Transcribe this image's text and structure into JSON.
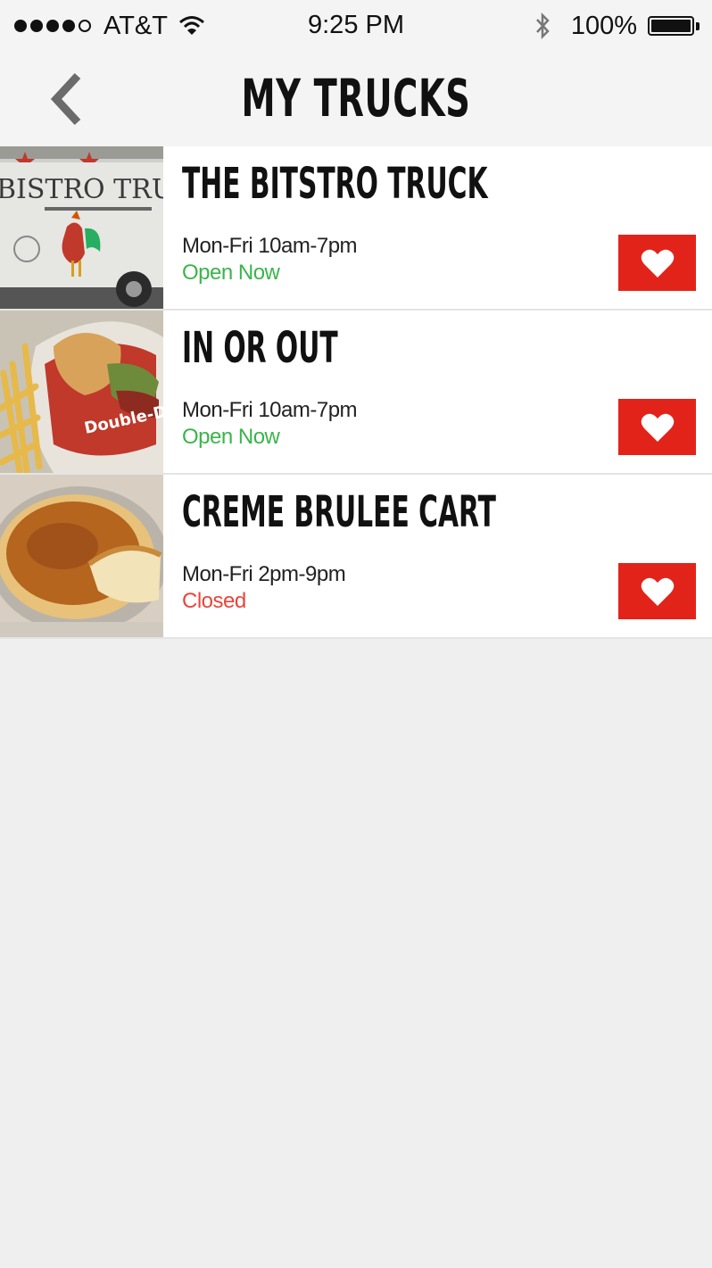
{
  "status_bar": {
    "carrier": "AT&T",
    "time": "9:25 PM",
    "battery": "100%",
    "signal_bars": 4,
    "signal_total": 5
  },
  "nav": {
    "title": "MY TRUCKS",
    "back_icon": "chevron-left-icon"
  },
  "colors": {
    "accent": "#e2231a",
    "open": "#3ab54a",
    "closed": "#e8453c"
  },
  "trucks": [
    {
      "name": "THE BITSTRO TRUCK",
      "hours": "Mon-Fri 10am-7pm",
      "status": "Open Now",
      "status_color": "#3ab54a",
      "image_text": "BISTRO TRUC",
      "favorite_icon": "heart-icon"
    },
    {
      "name": "IN OR OUT",
      "hours": "Mon-Fri 10am-7pm",
      "status": "Open Now",
      "status_color": "#3ab54a",
      "image_text": "Double-Double",
      "favorite_icon": "heart-icon"
    },
    {
      "name": "CREME BRULEE CART",
      "hours": "Mon-Fri 2pm-9pm",
      "status": "Closed",
      "status_color": "#e8453c",
      "favorite_icon": "heart-icon"
    }
  ]
}
